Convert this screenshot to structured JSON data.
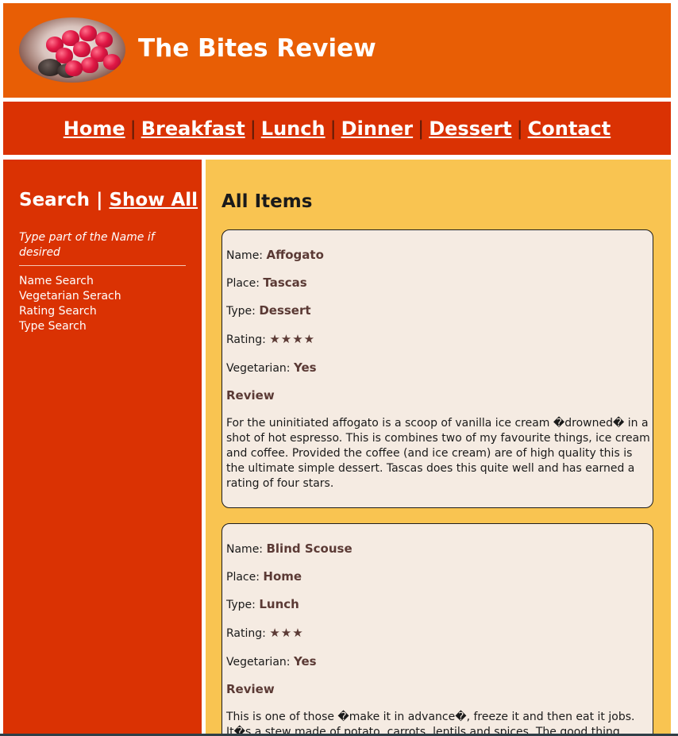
{
  "header": {
    "title": "The Bites Review",
    "logo_icon": "raspberries-bowl-icon"
  },
  "nav": {
    "items": [
      "Home",
      "Breakfast",
      "Lunch",
      "Dinner",
      "Dessert",
      "Contact"
    ],
    "separator": "|"
  },
  "sidebar": {
    "search_label": "Search",
    "separator": "|",
    "show_all_label": "Show All",
    "hint": "Type part of the Name if desired",
    "links": [
      "Name Search",
      "Vegetarian Serach",
      "Rating Search",
      "Type Search"
    ]
  },
  "main": {
    "title": "All Items",
    "labels": {
      "name": "Name:",
      "place": "Place:",
      "type": "Type:",
      "rating": "Rating:",
      "vegetarian": "Vegetarian:",
      "review": "Review"
    },
    "items": [
      {
        "name": "Affogato",
        "place": "Tascas",
        "type": "Dessert",
        "rating_stars": "★★★★",
        "rating_value": 4,
        "vegetarian": "Yes",
        "review": "For the uninitiated affogato is a scoop of vanilla ice cream �drowned� in a shot of hot espresso. This is combines two of my favourite things, ice cream and coffee. Provided the coffee (and ice cream) are of high quality this is the ultimate simple dessert. Tascas does this quite well and has earned a rating of four stars."
      },
      {
        "name": "Blind Scouse",
        "place": "Home",
        "type": "Lunch",
        "rating_stars": "★★★",
        "rating_value": 3,
        "vegetarian": "Yes",
        "review": "This is one of those �make it in advance�, freeze it and then eat it jobs. It�s a stew made of potato, carrots, lentils and spices. The good thing about"
      }
    ]
  },
  "colors": {
    "header_bg": "#e85e05",
    "nav_bg": "#da3203",
    "sidebar_bg": "#da3203",
    "main_bg": "#f9c451",
    "card_bg": "#f5ebe2",
    "value_text": "#5b3a35"
  }
}
